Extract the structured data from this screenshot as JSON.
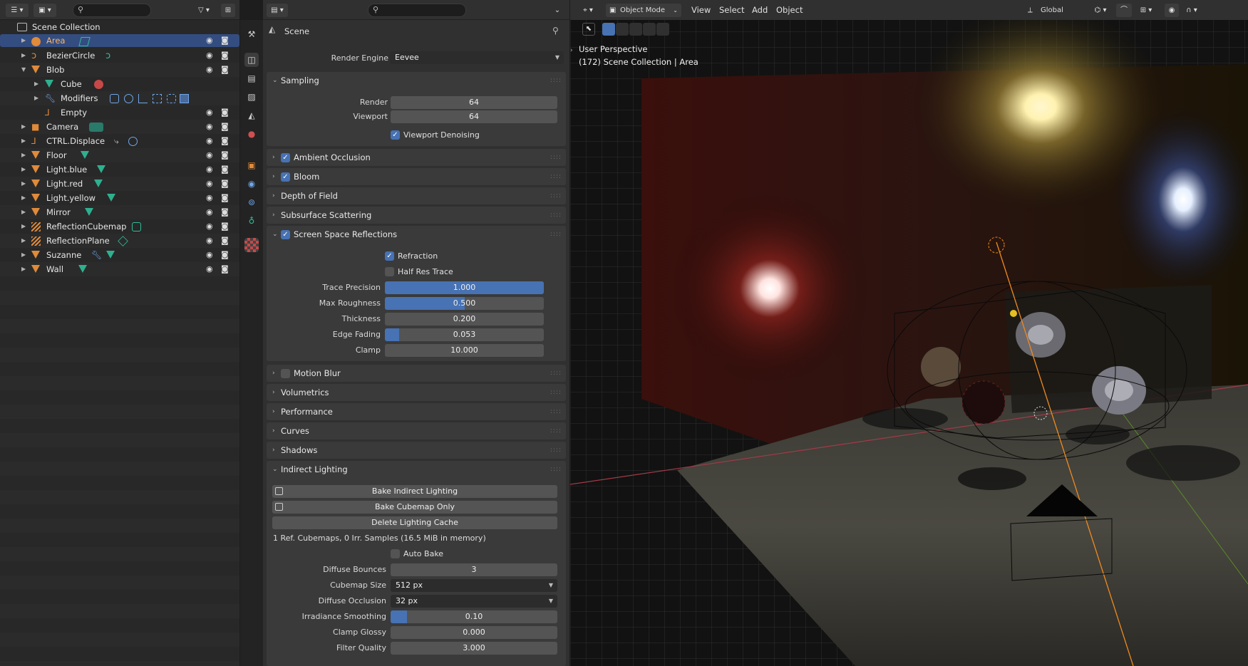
{
  "outliner": {
    "root_label": "Scene Collection",
    "items": [
      {
        "label": "Area",
        "type": "light"
      },
      {
        "label": "BezierCircle",
        "type": "curve"
      },
      {
        "label": "Blob",
        "type": "empty"
      },
      {
        "label": "Cube",
        "type": "mesh"
      },
      {
        "label": "Modifiers",
        "type": "wrench"
      },
      {
        "label": "Empty",
        "type": "empty"
      },
      {
        "label": "Camera",
        "type": "camera"
      },
      {
        "label": "CTRL.Displace",
        "type": "empty"
      },
      {
        "label": "Floor",
        "type": "mesh"
      },
      {
        "label": "Light.blue",
        "type": "mesh"
      },
      {
        "label": "Light.red",
        "type": "mesh"
      },
      {
        "label": "Light.yellow",
        "type": "mesh"
      },
      {
        "label": "Mirror",
        "type": "mesh"
      },
      {
        "label": "ReflectionCubemap",
        "type": "probe"
      },
      {
        "label": "ReflectionPlane",
        "type": "probe"
      },
      {
        "label": "Suzanne",
        "type": "mesh"
      },
      {
        "label": "Wall",
        "type": "mesh"
      }
    ]
  },
  "properties": {
    "context_title": "Scene",
    "render_engine_label": "Render Engine",
    "render_engine_value": "Eevee",
    "sampling": {
      "title": "Sampling",
      "render_label": "Render",
      "render_value": "64",
      "viewport_label": "Viewport",
      "viewport_value": "64",
      "denoise_label": "Viewport Denoising"
    },
    "panels": {
      "ambient_occlusion": "Ambient Occlusion",
      "bloom": "Bloom",
      "depth_of_field": "Depth of Field",
      "subsurface": "Subsurface Scattering",
      "ssr": "Screen Space Reflections",
      "motion_blur": "Motion Blur",
      "volumetrics": "Volumetrics",
      "performance": "Performance",
      "curves": "Curves",
      "shadows": "Shadows",
      "indirect": "Indirect Lighting"
    },
    "ssr": {
      "refraction_label": "Refraction",
      "half_res_label": "Half Res Trace",
      "fields": [
        {
          "label": "Trace Precision",
          "value": "1.000",
          "fill": 1.0
        },
        {
          "label": "Max Roughness",
          "value": "0.500",
          "fill": 0.5
        },
        {
          "label": "Thickness",
          "value": "0.200",
          "fill": 0.0
        },
        {
          "label": "Edge Fading",
          "value": "0.053",
          "fill": 0.09
        },
        {
          "label": "Clamp",
          "value": "10.000",
          "fill": 0.0
        }
      ]
    },
    "indirect": {
      "bake_indirect": "Bake Indirect Lighting",
      "bake_cubemap": "Bake Cubemap Only",
      "delete_cache": "Delete Lighting Cache",
      "info": "1 Ref. Cubemaps, 0 Irr. Samples (16.5 MiB in memory)",
      "auto_bake": "Auto Bake",
      "diffuse_bounces_label": "Diffuse Bounces",
      "diffuse_bounces_value": "3",
      "cubemap_size_label": "Cubemap Size",
      "cubemap_size_value": "512 px",
      "diffuse_occlusion_label": "Diffuse Occlusion",
      "diffuse_occlusion_value": "32 px",
      "irradiance_smoothing_label": "Irradiance Smoothing",
      "irradiance_smoothing_value": "0.10",
      "irradiance_smoothing_fill": 0.1,
      "clamp_glossy_label": "Clamp Glossy",
      "clamp_glossy_value": "0.000",
      "filter_quality_label": "Filter Quality",
      "filter_quality_value": "3.000"
    }
  },
  "viewport": {
    "mode": "Object Mode",
    "menus": [
      "View",
      "Select",
      "Add",
      "Object"
    ],
    "orientation": "Global",
    "perspective": "User Perspective",
    "collection_info": "(172) Scene Collection | Area"
  },
  "colors": {
    "accent": "#4772b3",
    "selected_row": "#334d80",
    "object_icon": "#e08a3a",
    "data_icon": "#2fbf9a"
  }
}
